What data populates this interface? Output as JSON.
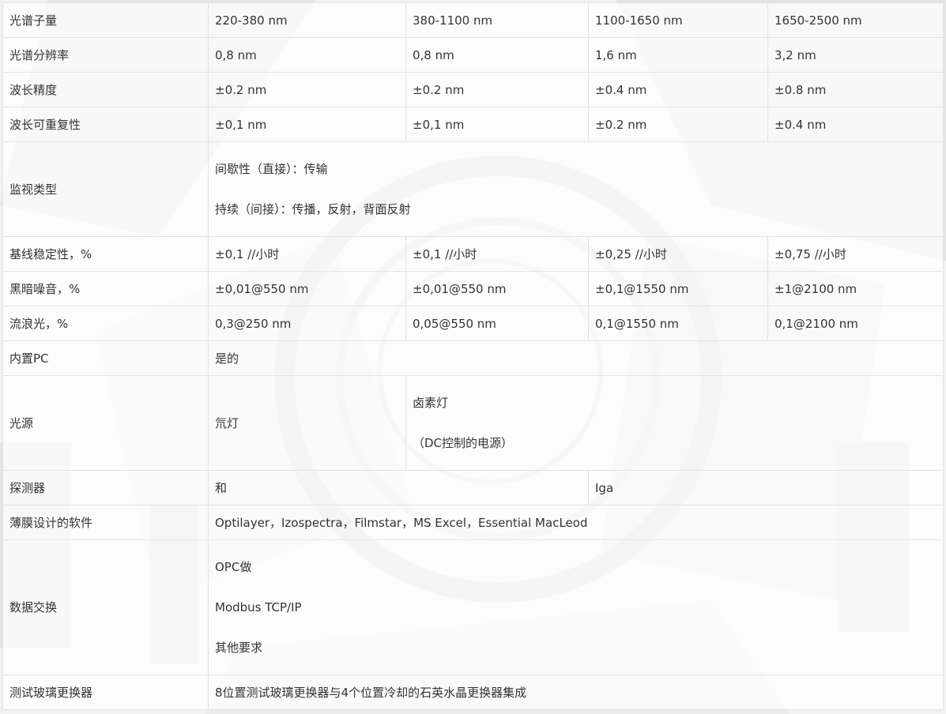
{
  "table": {
    "header": {
      "label": "光谱子量",
      "ranges": [
        "220-380 nm",
        "380-1100 nm",
        "1100-1650 nm",
        "1650-2500 nm"
      ]
    },
    "resolution": {
      "label": "光谱分辨率",
      "values": [
        "0,8 nm",
        "0,8 nm",
        "1,6 nm",
        "3,2 nm"
      ]
    },
    "accuracy": {
      "label": "波长精度",
      "values": [
        "±0.2 nm",
        "±0.2 nm",
        "±0.4 nm",
        "±0.8 nm"
      ]
    },
    "repeatability": {
      "label": "波长可重复性",
      "values": [
        "±0,1 nm",
        "±0,1 nm",
        "±0.2 nm",
        "±0.4 nm"
      ]
    },
    "monitoring": {
      "label": "监视类型",
      "lines": [
        "间歇性（直接）：传输",
        "持续（间接）：传播，反射，背面反射"
      ]
    },
    "baseline": {
      "label": "基线稳定性，%",
      "values": [
        "±0,1 //小时",
        "±0,1 //小时",
        "±0,25 //小时",
        "±0,75 //小时"
      ]
    },
    "dark_noise": {
      "label": "黑暗噪音，%",
      "values": [
        "±0,01@550 nm",
        "±0,01@550 nm",
        "±0,1@1550 nm",
        "±1@2100 nm"
      ]
    },
    "stray_light": {
      "label": "流浪光，%",
      "values": [
        "0,3@250 nm",
        "0,05@550 nm",
        "0,1@1550 nm",
        "0,1@2100 nm"
      ]
    },
    "builtin_pc": {
      "label": "内置PC",
      "value": "是的"
    },
    "light_source": {
      "label": "光源",
      "lamp1": "氘灯",
      "lamp2_lines": [
        "卤素灯",
        "（DC控制的电源）"
      ]
    },
    "detector": {
      "label": "探测器",
      "values": [
        "和",
        "Iga"
      ]
    },
    "software": {
      "label": "薄膜设计的软件",
      "value": "Optilayer，Izospectra，Filmstar，MS Excel，Essential MacLeod"
    },
    "data_exchange": {
      "label": "数据交换",
      "lines": [
        "OPC做",
        "Modbus TCP/IP",
        "其他要求"
      ]
    },
    "glass_changer": {
      "label": "测试玻璃更换器",
      "value": "8位置测试玻璃更换器与4个位置冷却的石英水晶更换器集成"
    }
  }
}
